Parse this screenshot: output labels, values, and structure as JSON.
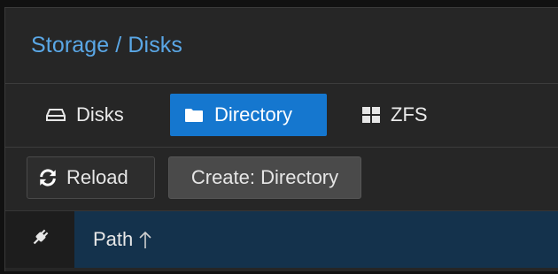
{
  "header": {
    "title": "Storage / Disks"
  },
  "tabs": [
    {
      "label": "Disks",
      "icon": "hdd-icon",
      "active": false
    },
    {
      "label": "Directory",
      "icon": "folder-icon",
      "active": true
    },
    {
      "label": "ZFS",
      "icon": "grid-icon",
      "active": false
    }
  ],
  "toolbar": {
    "reload_label": "Reload",
    "create_label": "Create: Directory"
  },
  "grid": {
    "columns": [
      {
        "label": "",
        "icon": "plug-icon"
      },
      {
        "label": "Path",
        "sort": "ascending"
      }
    ]
  },
  "colors": {
    "accent": "#1577cf",
    "title": "#5aa7e6",
    "background": "#262626",
    "grid_header": "#14324c"
  }
}
